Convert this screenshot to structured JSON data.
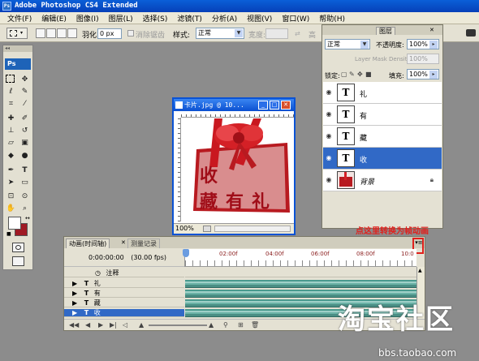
{
  "window": {
    "title": "Adobe Photoshop CS4 Extended",
    "app_icon": "Ps"
  },
  "menu": [
    "文件(F)",
    "编辑(E)",
    "图像(I)",
    "图层(L)",
    "选择(S)",
    "滤镜(T)",
    "分析(A)",
    "视图(V)",
    "窗口(W)",
    "帮助(H)"
  ],
  "options": {
    "feather_label": "羽化:",
    "feather_value": "0 px",
    "antialias_label": "消除锯齿",
    "style_label": "样式:",
    "style_value": "正常",
    "width_label": "宽度:",
    "height_label": "高"
  },
  "toolbox": {
    "logo": "Ps",
    "grip": "◂◂"
  },
  "document": {
    "title": "卡片.jpg @ 10...",
    "zoom": "100%",
    "art_chars": [
      "收",
      "藏",
      "有",
      "礼"
    ]
  },
  "layers_panel": {
    "tab": "图层",
    "blend_mode": "正常",
    "opacity_label": "不透明度:",
    "opacity_value": "100%",
    "density_label": "Layer Mask Density:",
    "density_value": "100%",
    "lock_label": "锁定:",
    "fill_label": "填充:",
    "fill_value": "100%",
    "layers": [
      {
        "thumb": "T",
        "name": "礼",
        "selected": false
      },
      {
        "thumb": "T",
        "name": "有",
        "selected": false
      },
      {
        "thumb": "T",
        "name": "藏",
        "selected": false
      },
      {
        "thumb": "T",
        "name": "收",
        "selected": true
      },
      {
        "thumb": "",
        "name": "背景",
        "selected": false
      }
    ]
  },
  "annotation": "点这里转换为帧动画",
  "animation_panel": {
    "tab_active": "动画(时间轴)",
    "tab_other": "测量记录",
    "time": "0:00:00:00",
    "fps": "(30.00 fps)",
    "ticks": [
      "02:00f",
      "04:00f",
      "06:00f",
      "08:00f",
      "10:0"
    ],
    "comments_label": "注释",
    "tracks": [
      {
        "name": "礼",
        "selected": false
      },
      {
        "name": "有",
        "selected": false
      },
      {
        "name": "藏",
        "selected": false
      },
      {
        "name": "收",
        "selected": true
      }
    ]
  },
  "watermark": {
    "text": "淘宝社区",
    "url": "bbs.taobao.com"
  },
  "colors": {
    "accent": "#3169c6",
    "annotation": "#e0201c",
    "titlebar": "#0a52d4"
  }
}
